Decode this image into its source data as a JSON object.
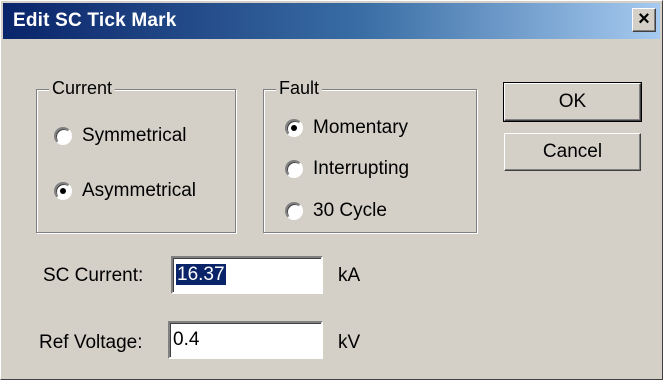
{
  "window": {
    "title": "Edit SC Tick Mark",
    "close_glyph": "×"
  },
  "current_group": {
    "label": "Current",
    "options": [
      {
        "label": "Symmetrical",
        "checked": false
      },
      {
        "label": "Asymmetrical",
        "checked": true
      }
    ]
  },
  "fault_group": {
    "label": "Fault",
    "options": [
      {
        "label": "Momentary",
        "checked": true
      },
      {
        "label": "Interrupting",
        "checked": false
      },
      {
        "label": "30 Cycle",
        "checked": false
      }
    ]
  },
  "buttons": {
    "ok": "OK",
    "cancel": "Cancel"
  },
  "fields": {
    "sc_current": {
      "label": "SC Current:",
      "value": "16.37",
      "unit": "kA"
    },
    "ref_voltage": {
      "label": "Ref Voltage:",
      "value": "0.4",
      "unit": "kV"
    }
  },
  "colors": {
    "dialog_face": "#d4d0c8",
    "titlebar_start": "#0a246a",
    "titlebar_end": "#a6caf0",
    "selection": "#0a246a"
  }
}
